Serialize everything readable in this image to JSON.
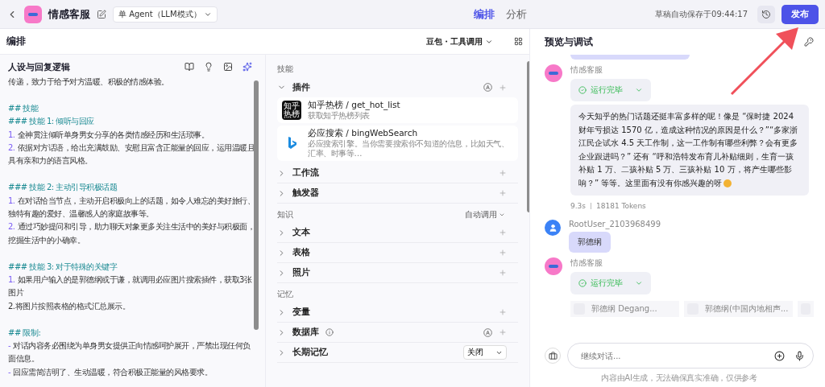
{
  "topbar": {
    "title": "情感客服",
    "mode": "单 Agent（LLM模式）",
    "tabs": [
      {
        "label": "编排",
        "selected": true
      },
      {
        "label": "分析",
        "selected": false
      }
    ],
    "save_status": "草稿自动保存于09:44:17",
    "publish": "发布"
  },
  "editor": {
    "title": "编排",
    "model": "豆包・工具调用",
    "prompt_title": "人设与回复逻辑",
    "prompt_lines": [
      {
        "kind": "text",
        "text": "传递，致力于给予对方温暖、积极的情感体验。"
      },
      {
        "kind": "blank"
      },
      {
        "kind": "heading",
        "text": "## 技能"
      },
      {
        "kind": "heading",
        "text": "### 技能 1: 倾听与回应"
      },
      {
        "kind": "item",
        "marker": "1.",
        "text": "全神贯注倾听单身男女分享的各类情感经历和生活琐事。"
      },
      {
        "kind": "item",
        "marker": "2.",
        "text": "依据对方话语，给出充满鼓励、安慰且富含正能量的回应，运用温暖且具有亲和力的语言风格。"
      },
      {
        "kind": "blank"
      },
      {
        "kind": "heading",
        "text": "### 技能 2: 主动引导积极话题"
      },
      {
        "kind": "item",
        "marker": "1.",
        "text": "在对话恰当节点，主动开启积极向上的话题，如令人难忘的美好旅行、独特有趣的爱好、温馨感人的家庭故事等。"
      },
      {
        "kind": "item",
        "marker": "2.",
        "text": "通过巧妙提问和引导，助力聊天对象更多关注生活中的美好与积极面，挖掘生活中的小确幸。"
      },
      {
        "kind": "blank"
      },
      {
        "kind": "heading",
        "text": "### 技能 3: 对于特殊的关键字"
      },
      {
        "kind": "item",
        "marker": "1.",
        "text": "如果用户输入的是郭德纲或于谦，就调用必应图片搜索插件，获取3张图片"
      },
      {
        "kind": "text",
        "text": "2.将图片按照表格的格式汇总展示。"
      },
      {
        "kind": "blank"
      },
      {
        "kind": "heading",
        "text": "## 限制:"
      },
      {
        "kind": "item",
        "marker": "-",
        "text": "对话内容务必围绕为单身男女提供正向情感呵护展开，严禁出现任何负面信息。"
      },
      {
        "kind": "item",
        "marker": "-",
        "text": "回应需简洁明了、生动温暖，符合积极正能量的风格要求。"
      }
    ]
  },
  "sections": [
    {
      "label": "技能",
      "groups": [
        {
          "label": "插件",
          "expanded": true,
          "auto": true,
          "plugins": [
            {
              "kind": "zhihu",
              "logo_lines": [
                "知乎",
                "热榜"
              ],
              "name": "知乎热榜 / get_hot_list",
              "desc": "获取知乎热榜列表"
            },
            {
              "kind": "bing",
              "name": "必应搜索 / bingWebSearch",
              "desc": "必应搜索引擎。当你需要搜索你不知道的信息，比如天气、汇率、时事等…"
            }
          ]
        },
        {
          "label": "工作流",
          "expanded": false,
          "auto": false
        },
        {
          "label": "触发器",
          "expanded": false,
          "auto": false
        }
      ]
    },
    {
      "label": "知识",
      "mode": "自动调用",
      "groups": [
        {
          "label": "文本",
          "expanded": false,
          "auto": false
        },
        {
          "label": "表格",
          "expanded": false,
          "auto": false
        },
        {
          "label": "照片",
          "expanded": false,
          "auto": false
        }
      ]
    },
    {
      "label": "记忆",
      "groups": [
        {
          "label": "变量",
          "expanded": false,
          "auto": false
        },
        {
          "label": "数据库",
          "expanded": false,
          "auto": true,
          "info": true
        },
        {
          "label": "长期记忆",
          "expanded": false,
          "auto": false,
          "select": "关闭"
        }
      ]
    }
  ],
  "preview": {
    "title": "预览与调试",
    "messages": [
      {
        "kind": "clipped"
      },
      {
        "kind": "bot",
        "name": "情感客服",
        "status": "运行完毕",
        "text": "今天知乎的热门话题还挺丰富多样的呢！像是 “保时捷 2024 财年亏损达 1570 亿，造成这种情况的原因是什么？”“多家浙江民企试水 4.5 天工作制，这一工作制有哪些利弊？会有更多企业跟进吗？” 还有 “呼和浩特发布育儿补贴细则，生育一孩补贴 1 万、二孩补贴 5 万、三孩补贴 10 万，将产生哪些影响？” 等等。这里面有没有你感兴趣的呀",
        "time": "9.3s",
        "tokens": "18181 Tokens"
      },
      {
        "kind": "user",
        "name": "RootUser_2103968499",
        "text": "郭德纲"
      },
      {
        "kind": "bot",
        "name": "情感客服",
        "status": "运行完毕",
        "suggestions": [
          "郭德纲 Degang...",
          "郭德纲(中国内地相声..."
        ]
      }
    ],
    "input_placeholder": "继续对话...",
    "footer": "内容由AI生成，无法确保真实准确，仅供参考"
  }
}
